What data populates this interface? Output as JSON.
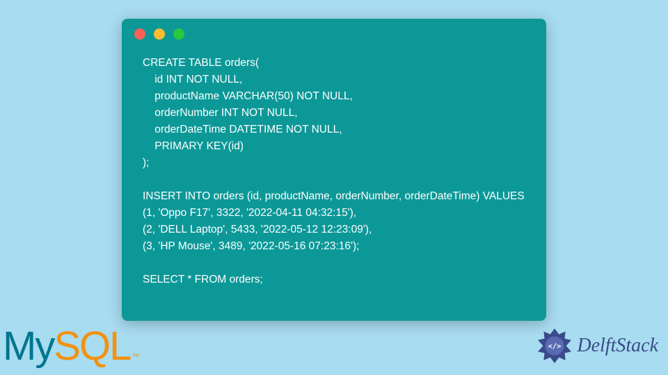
{
  "code": {
    "lines": [
      "CREATE TABLE orders(",
      "    id INT NOT NULL,",
      "    productName VARCHAR(50) NOT NULL,",
      "    orderNumber INT NOT NULL,",
      "    orderDateTime DATETIME NOT NULL,",
      "    PRIMARY KEY(id)",
      ");",
      "",
      "INSERT INTO orders (id, productName, orderNumber, orderDateTime) VALUES",
      "(1, 'Oppo F17', 3322, '2022-04-11 04:32:15'),",
      "(2, 'DELL Laptop', 5433, '2022-05-12 12:23:09'),",
      "(3, 'HP Mouse', 3489, '2022-05-16 07:23:16');",
      "",
      "SELECT * FROM orders;"
    ],
    "full": "CREATE TABLE orders(\n    id INT NOT NULL,\n    productName VARCHAR(50) NOT NULL,\n    orderNumber INT NOT NULL,\n    orderDateTime DATETIME NOT NULL,\n    PRIMARY KEY(id)\n);\n\nINSERT INTO orders (id, productName, orderNumber, orderDateTime) VALUES\n(1, 'Oppo F17', 3322, '2022-04-11 04:32:15'),\n(2, 'DELL Laptop', 5433, '2022-05-12 12:23:09'),\n(3, 'HP Mouse', 3489, '2022-05-16 07:23:16');\n\nSELECT * FROM orders;"
  },
  "logo_mysql": {
    "my": "My",
    "sql": "SQL",
    "tm": "™"
  },
  "logo_delftstack": {
    "text": "DelftStack"
  },
  "colors": {
    "background": "#a8dcf0",
    "window": "#0d9898",
    "code_text": "#ffffff",
    "mysql_my": "#00758f",
    "mysql_sql": "#f29111",
    "delft_text": "#3a4a8a"
  }
}
